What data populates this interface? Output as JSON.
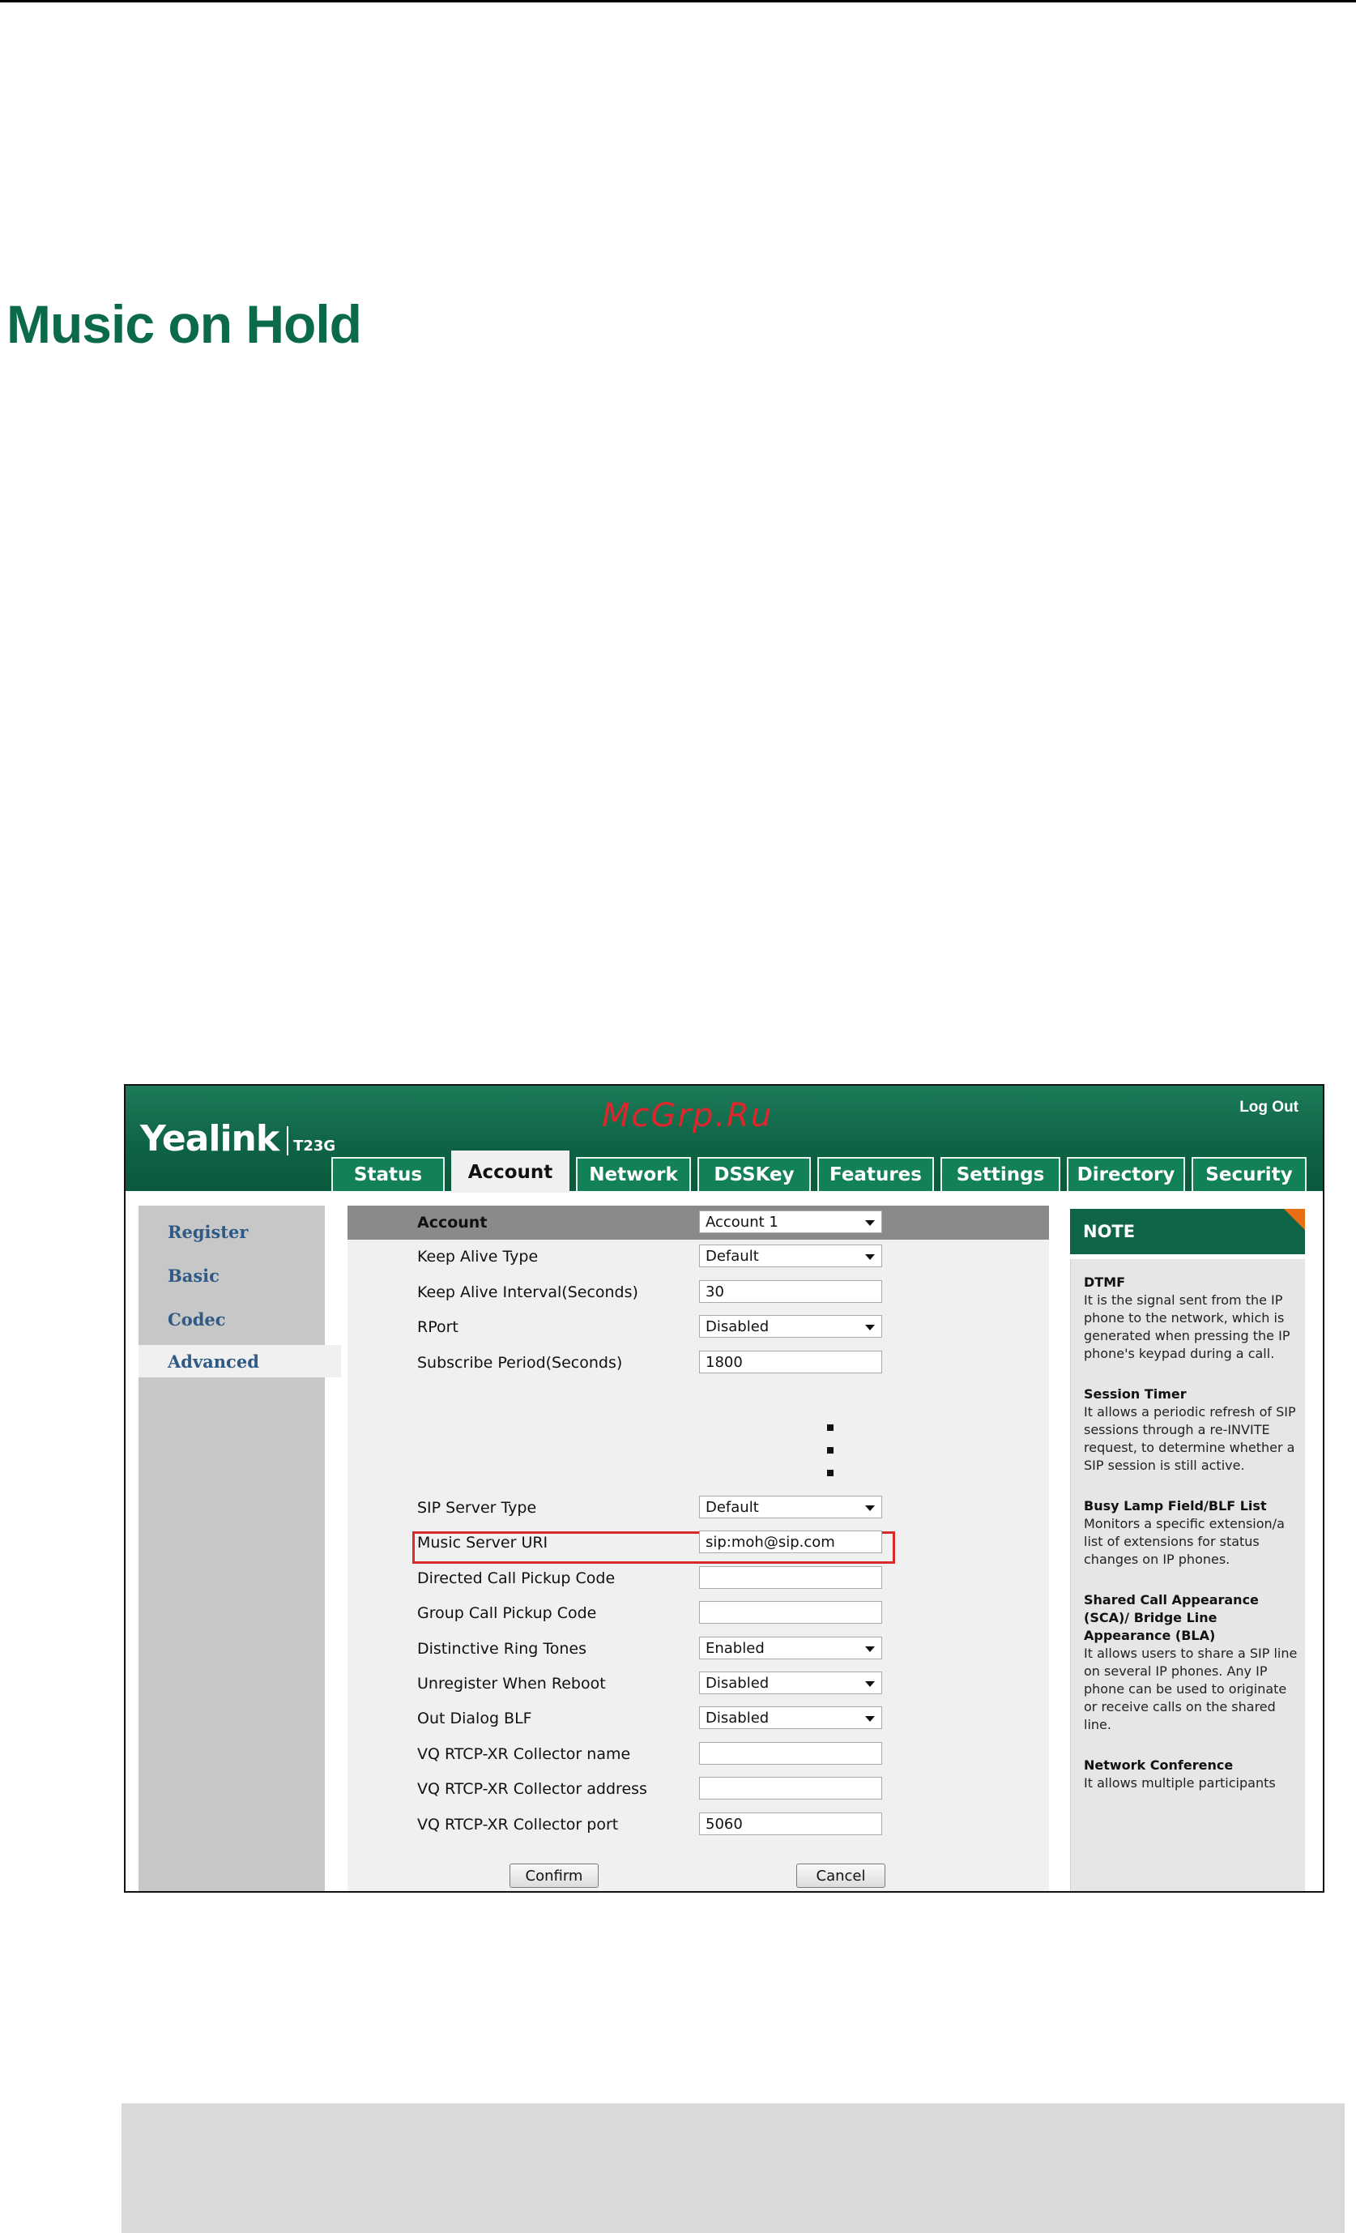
{
  "page": {
    "title": "Music on Hold"
  },
  "ui": {
    "logo": "Yealink",
    "model": "T23G",
    "watermark": "McGrp.Ru",
    "logout": "Log Out",
    "tabs": [
      "Status",
      "Account",
      "Network",
      "DSSKey",
      "Features",
      "Settings",
      "Directory",
      "Security"
    ],
    "active_tab": "Account",
    "sidebar": [
      "Register",
      "Basic",
      "Codec",
      "Advanced"
    ],
    "active_sidebar": "Advanced",
    "account": {
      "label": "Account",
      "value": "Account 1"
    },
    "rows_top": [
      {
        "label": "Keep Alive Type",
        "value": "Default",
        "type": "select"
      },
      {
        "label": "Keep Alive Interval(Seconds)",
        "value": "30",
        "type": "input"
      },
      {
        "label": "RPort",
        "value": "Disabled",
        "type": "select"
      },
      {
        "label": "Subscribe Period(Seconds)",
        "value": "1800",
        "type": "input"
      }
    ],
    "rows_bottom": [
      {
        "label": "SIP Server Type",
        "value": "Default",
        "type": "select"
      },
      {
        "label": "Music Server URI",
        "value": "sip:moh@sip.com",
        "type": "input"
      },
      {
        "label": "Directed Call Pickup Code",
        "value": "",
        "type": "input"
      },
      {
        "label": "Group Call Pickup Code",
        "value": "",
        "type": "input"
      },
      {
        "label": "Distinctive Ring Tones",
        "value": "Enabled",
        "type": "select"
      },
      {
        "label": "Unregister When Reboot",
        "value": "Disabled",
        "type": "select"
      },
      {
        "label": "Out Dialog BLF",
        "value": "Disabled",
        "type": "select"
      },
      {
        "label": "VQ RTCP-XR Collector name",
        "value": "",
        "type": "input"
      },
      {
        "label": "VQ RTCP-XR Collector address",
        "value": "",
        "type": "input"
      },
      {
        "label": "VQ RTCP-XR Collector port",
        "value": "5060",
        "type": "input"
      }
    ],
    "buttons": {
      "confirm": "Confirm",
      "cancel": "Cancel"
    },
    "note": {
      "title": "NOTE",
      "items": [
        {
          "h": "DTMF",
          "t": "It is the signal sent from the IP phone to the network, which is generated when pressing the IP phone's keypad during a call."
        },
        {
          "h": "Session Timer",
          "t": "It allows a periodic refresh of SIP sessions through a re-INVITE request, to determine whether a SIP session is still active."
        },
        {
          "h": "Busy Lamp Field/BLF List",
          "t": "Monitors a specific extension/a list of extensions for status changes on IP phones."
        },
        {
          "h": "Shared Call Appearance (SCA)/ Bridge Line Appearance (BLA)",
          "t": "It allows users to share a SIP line on several IP phones. Any IP phone can be used to originate or receive calls on the shared line."
        },
        {
          "h": "Network Conference",
          "t": "It allows multiple participants"
        }
      ]
    }
  }
}
